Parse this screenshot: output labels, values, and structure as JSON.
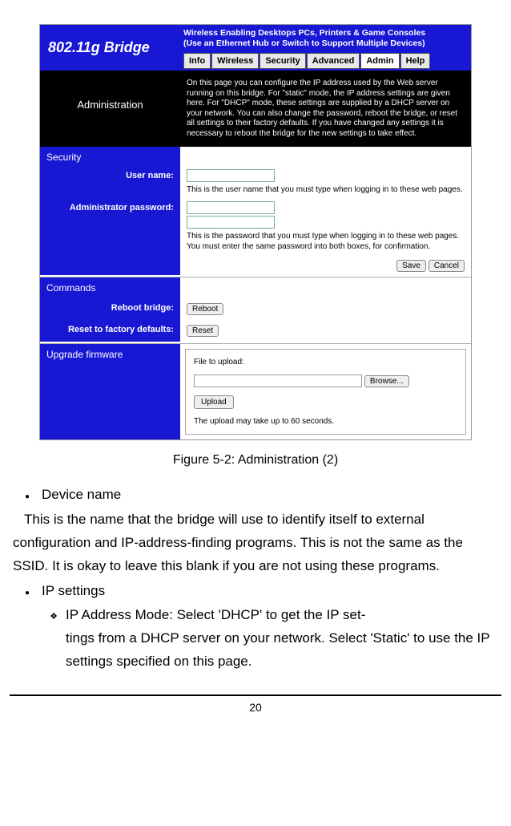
{
  "header": {
    "title": "802.11g Bridge",
    "subtitle_line1": "Wireless Enabling Desktops PCs, Printers & Game Consoles",
    "subtitle_line2": "(Use an Ethernet Hub or Switch to Support Multiple Devices)",
    "tabs": [
      "Info",
      "Wireless",
      "Security",
      "Advanced",
      "Admin",
      "Help"
    ]
  },
  "admin": {
    "heading": "Administration",
    "intro": "On this page you can configure the IP address used by the Web server running on this bridge. For \"static\" mode, the IP address settings are given here. For \"DHCP\" mode, these settings are supplied by a DHCP server on your network. You can also change the password, reboot the bridge, or reset all settings to their factory defaults. If you have changed any settings it is necessary to reboot the bridge for the new settings to take effect."
  },
  "security": {
    "heading": "Security",
    "username_label": "User name:",
    "username_help": "This is the user name that you must type when logging in to these web pages.",
    "password_label": "Administrator password:",
    "password_help": "This is the password that you must type when logging in to these web pages. You must enter the same password into both boxes, for confirmation.",
    "save_btn": "Save",
    "cancel_btn": "Cancel"
  },
  "commands": {
    "heading": "Commands",
    "reboot_label": "Reboot bridge:",
    "reboot_btn": "Reboot",
    "reset_label": "Reset to factory defaults:",
    "reset_btn": "Reset"
  },
  "upgrade": {
    "heading": "Upgrade firmware",
    "file_label": "File to upload:",
    "browse_btn": "Browse...",
    "upload_btn": "Upload",
    "note": "The upload may take up to 60 seconds."
  },
  "caption": "Figure 5-2: Administration (2)",
  "doc": {
    "b1": "Device name",
    "p1": "This is the name that the bridge will use to identify itself to external configuration and IP-address-finding programs. This is not the same as the SSID. It is okay to leave this blank if you are not using these programs.",
    "b2": "IP settings",
    "sb1": "IP Address Mode: Select 'DHCP' to get the IP set-",
    "p2": "tings from a DHCP server on your network. Select 'Static' to use the IP settings specified on this page."
  },
  "page_number": "20"
}
